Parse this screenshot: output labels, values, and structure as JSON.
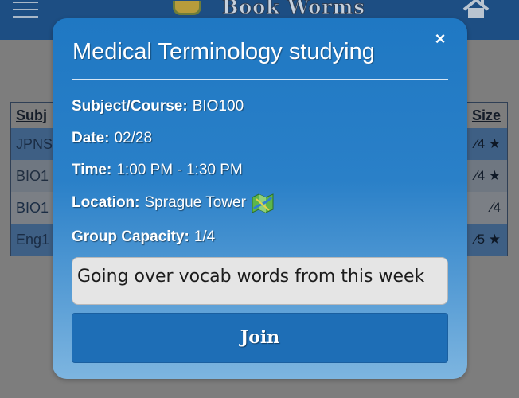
{
  "app": {
    "brand": "Book Worms",
    "table": {
      "head": {
        "subject": "Subj",
        "size": "Size"
      },
      "rows": [
        {
          "subject": "JPNS",
          "size": "⁄4 ★"
        },
        {
          "subject": "BIO1",
          "size": "⁄4 ★"
        },
        {
          "subject": "BIO1",
          "size": "⁄4"
        },
        {
          "subject": "Eng1",
          "size": "⁄5 ★"
        }
      ]
    }
  },
  "modal": {
    "title": "Medical Terminology studying",
    "close_label": "×",
    "subject_label": "Subject/Course:",
    "subject_value": "BIO100",
    "date_label": "Date:",
    "date_value": "02/28",
    "time_label": "Time:",
    "time_value": "1:00 PM - 1:30 PM",
    "location_label": "Location:",
    "location_value": "Sprague Tower",
    "capacity_label": "Group Capacity:",
    "capacity_value": "1/4",
    "description": "Going over vocab words from this week",
    "join_label": "Join"
  },
  "icons": {
    "map": "map-icon",
    "home": "home-icon",
    "menu": "hamburger-menu-icon"
  },
  "colors": {
    "header_bg": "#1d4e83",
    "modal_top": "#1f78c3",
    "modal_bottom": "#7db5e0",
    "join_button": "#1e6eb6"
  }
}
